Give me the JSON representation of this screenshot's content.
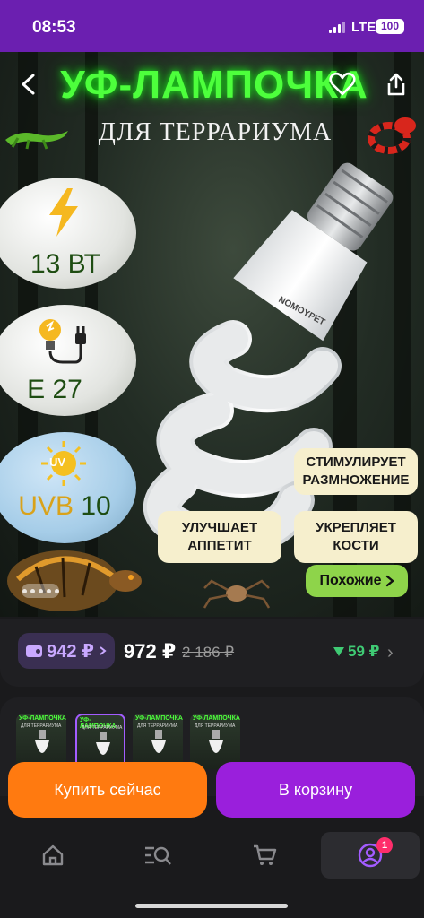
{
  "status_bar": {
    "time": "08:53",
    "network": "LTE",
    "battery": "100"
  },
  "hero": {
    "title": "УФ-ЛАМПОЧКА",
    "subtitle": "ДЛЯ ТЕРРАРИУМА",
    "brand": "NOMOYPET",
    "specs": [
      {
        "icon": "lightning-icon",
        "label": "13 ВТ"
      },
      {
        "icon": "plug-bulb-icon",
        "label": "E 27"
      },
      {
        "icon": "uv-sun-icon",
        "icon_text": "UV",
        "label_prefix": "UVB",
        "label": "10"
      }
    ],
    "benefits": [
      {
        "text": "СТИМУЛИРУЕТ РАЗМНОЖЕНИЕ"
      },
      {
        "text": "УЛУЧШАЕТ АППЕТИТ"
      },
      {
        "text": "УКРЕПЛЯЕТ КОСТИ"
      }
    ],
    "similar_label": "Похожие"
  },
  "price": {
    "wallet_amount": "942 ₽",
    "current": "972 ₽",
    "old": "2 186 ₽",
    "delta": "59 ₽"
  },
  "thumbnails": [
    {
      "title": "УФ-ЛАМПОЧКА",
      "sub": "ДЛЯ ТЕРРАРИУМА"
    },
    {
      "title": "УФ-ЛАМПОЧКА",
      "sub": "ДЛЯ ТЕРРАРИУМА"
    },
    {
      "title": "УФ-ЛАМПОЧКА",
      "sub": "ДЛЯ ТЕРРАРИУМА"
    },
    {
      "title": "УФ-ЛАМПОЧКА",
      "sub": "ДЛЯ ТЕРРАРИУМА"
    }
  ],
  "actions": {
    "buy_now": "Купить сейчас",
    "add_to_cart": "В корзину"
  },
  "nav": {
    "items": [
      "home-icon",
      "catalog-search-icon",
      "cart-icon",
      "profile-icon"
    ],
    "profile_badge": "1"
  },
  "colors": {
    "accent": "#9a1fdc",
    "buy": "#ff7a10",
    "status": "#6b1fb0",
    "neon": "#4dff3c",
    "positive": "#3fca74"
  }
}
